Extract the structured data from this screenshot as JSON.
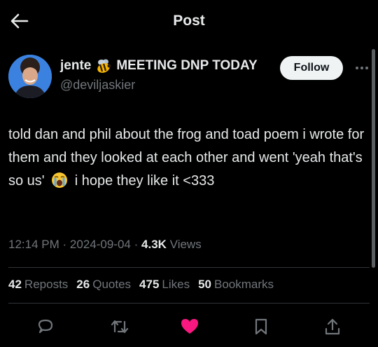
{
  "topbar": {
    "title": "Post",
    "back_icon": "arrow-left-icon"
  },
  "author": {
    "name": "jente",
    "name_suffix": "MEETING DNP TODAY",
    "name_emoji": "bee-emoji",
    "handle": "@deviljaskier",
    "follow_label": "Follow",
    "more_icon": "ellipsis-icon"
  },
  "post": {
    "text_1": "told dan and phil about the frog and toad poem i wrote for them and they looked at each other and went 'yeah that's so us'",
    "emoji": "crying-face-emoji",
    "text_2": "i hope they like it <333"
  },
  "meta": {
    "time": "12:14 PM",
    "sep1": "·",
    "date": "2024-09-04",
    "sep2": "·",
    "views_count": "4.3K",
    "views_label": "Views"
  },
  "stats": [
    {
      "count": "42",
      "label": "Reposts"
    },
    {
      "count": "26",
      "label": "Quotes"
    },
    {
      "count": "475",
      "label": "Likes"
    },
    {
      "count": "50",
      "label": "Bookmarks"
    }
  ],
  "actions": [
    "reply-icon",
    "repost-icon",
    "like-icon",
    "bookmark-icon",
    "share-icon"
  ],
  "colors": {
    "background": "#000000",
    "text": "#e7e9ea",
    "muted": "#71767b",
    "like": "#f91880",
    "divider": "#2f3336"
  }
}
